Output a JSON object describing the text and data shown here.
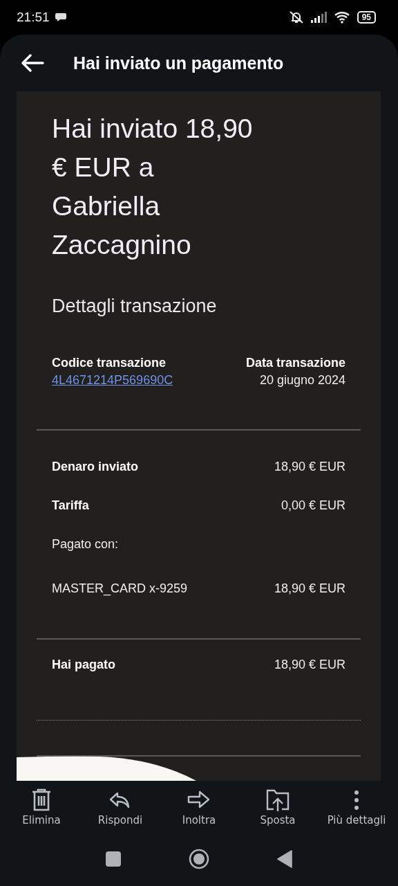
{
  "status_bar": {
    "time": "21:51",
    "battery": "95"
  },
  "header": {
    "title": "Hai inviato un pagamento"
  },
  "message": {
    "headline": "Hai inviato 18,90 € EUR a Gabriella Zaccagnino",
    "section_title": "Dettagli transazione",
    "code": {
      "label": "Codice transazione",
      "value": "4L4671214P569690C"
    },
    "date": {
      "label": "Data transazione",
      "value": "20 giugno 2024"
    },
    "breakdown": [
      {
        "kind": "bold",
        "label": "Denaro inviato",
        "value": "18,90 € EUR"
      },
      {
        "kind": "bold",
        "label": "Tariffa",
        "value": "0,00 € EUR"
      },
      {
        "kind": "note",
        "label": "Pagato con:"
      },
      {
        "kind": "plain",
        "label": "MASTER_CARD x-9259",
        "value": "18,90 € EUR"
      }
    ],
    "total": {
      "label": "Hai pagato",
      "value": "18,90 € EUR"
    }
  },
  "toolbar": [
    {
      "kind": "trash",
      "label": "Elimina"
    },
    {
      "kind": "reply",
      "label": "Rispondi"
    },
    {
      "kind": "forward",
      "label": "Inoltra"
    },
    {
      "kind": "move",
      "label": "Sposta"
    },
    {
      "kind": "more",
      "label": "Più dettagli"
    }
  ]
}
